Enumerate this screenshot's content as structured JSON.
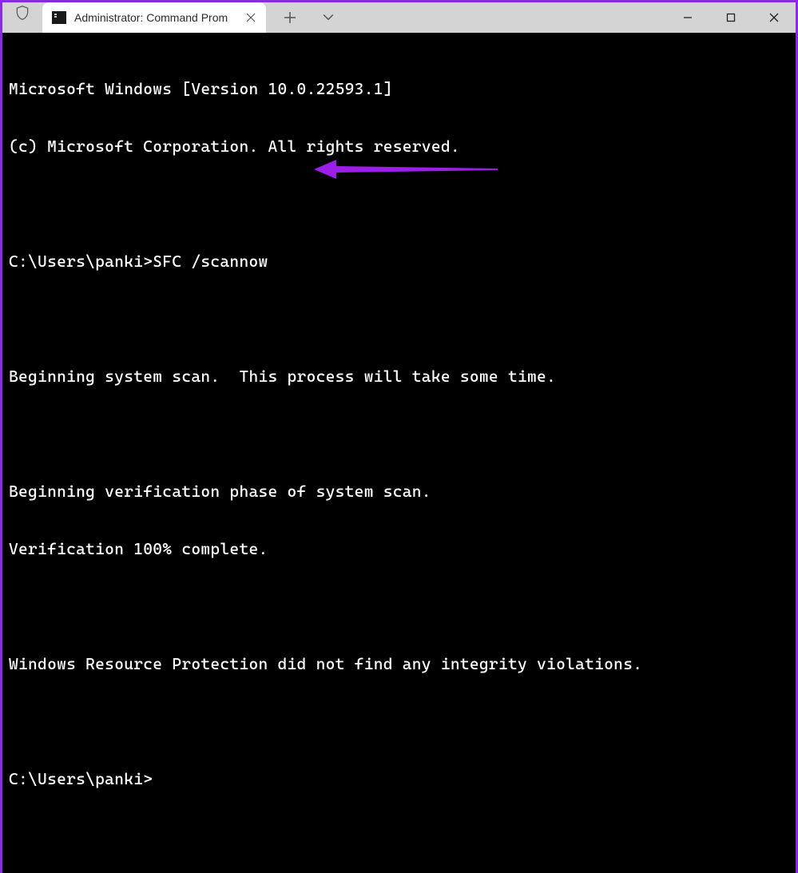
{
  "titlebar": {
    "tab_title": "Administrator: Command Prom",
    "shield_icon_name": "shield-icon",
    "tab_icon_name": "cmd-icon",
    "close_tab_label": "×",
    "new_tab_label": "+",
    "dropdown_label": "⌄"
  },
  "window_controls": {
    "minimize": "minimize",
    "maximize": "maximize",
    "close": "close"
  },
  "terminal": {
    "lines": [
      "Microsoft Windows [Version 10.0.22593.1]",
      "(c) Microsoft Corporation. All rights reserved.",
      "",
      "C:\\Users\\panki>SFC /scannow",
      "",
      "Beginning system scan.  This process will take some time.",
      "",
      "Beginning verification phase of system scan.",
      "Verification 100% complete.",
      "",
      "Windows Resource Protection did not find any integrity violations.",
      "",
      "C:\\Users\\panki>"
    ]
  },
  "annotation": {
    "color": "#9b1fe8"
  }
}
